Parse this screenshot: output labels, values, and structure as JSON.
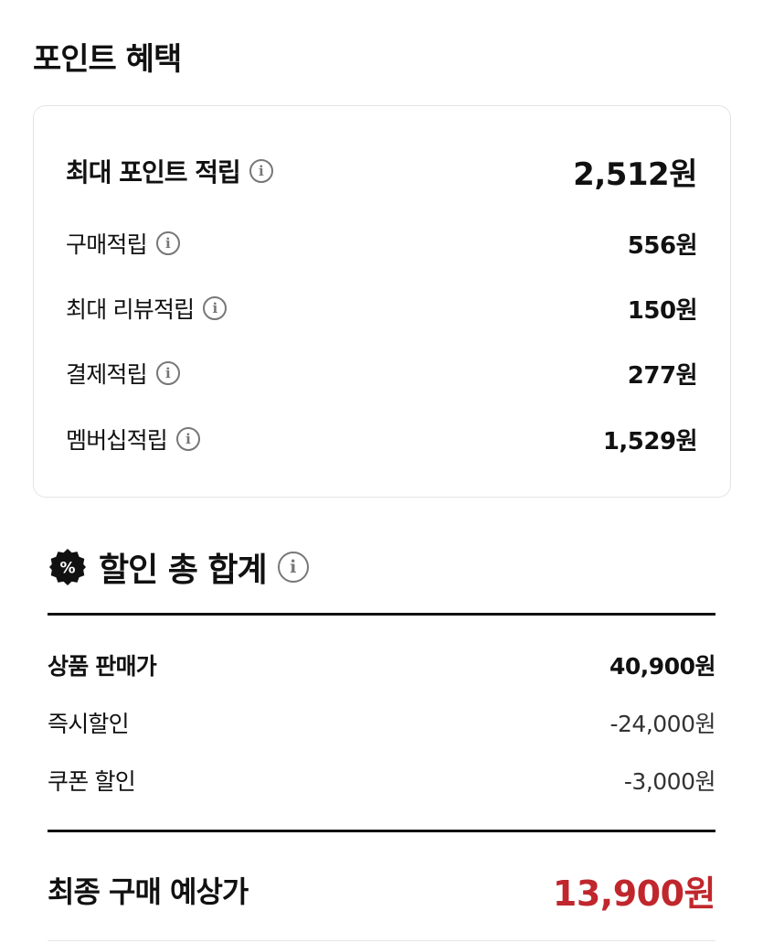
{
  "points_section": {
    "title": "포인트 혜택",
    "max_points": {
      "label": "최대 포인트 적립",
      "value": "2,512원"
    },
    "items": [
      {
        "label": "구매적립",
        "value": "556원"
      },
      {
        "label": "최대 리뷰적립",
        "value": "150원"
      },
      {
        "label": "결제적립",
        "value": "277원"
      },
      {
        "label": "멤버십적립",
        "value": "1,529원"
      }
    ]
  },
  "discount_section": {
    "badge_symbol": "%",
    "title": "할인 총 합계",
    "rows": [
      {
        "label": "상품 판매가",
        "value": "40,900원"
      },
      {
        "label": "즉시할인",
        "value": "-24,000원"
      },
      {
        "label": "쿠폰 할인",
        "value": "-3,000원"
      }
    ],
    "final": {
      "label": "최종 구매 예상가",
      "value": "13,900원"
    }
  },
  "icons": {
    "info": "info-circle-icon",
    "badge": "percent-badge-icon"
  },
  "colors": {
    "text": "#111111",
    "final_price": "#c0272d",
    "card_border": "#e4e4e4",
    "info_icon": "#777777"
  }
}
